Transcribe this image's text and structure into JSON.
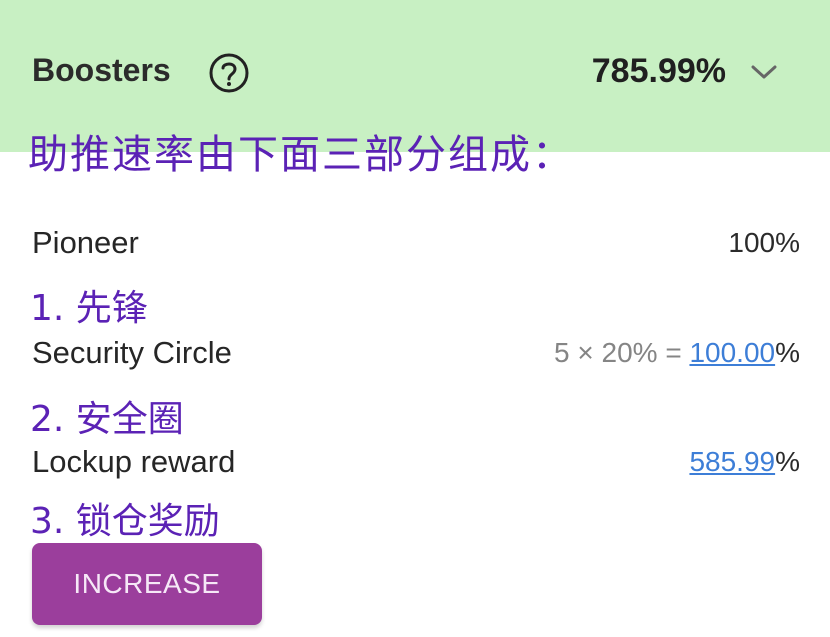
{
  "header": {
    "title": "Boosters",
    "help_icon": "question-circle-icon",
    "total": "785.99%",
    "expand_icon": "chevron-down-icon",
    "background_color": "#c8f0c3"
  },
  "annotations": {
    "main": "助推速率由下面三部分组成：",
    "item1": "1. 先锋",
    "item2": "2. 安全圈",
    "item3": "3. 锁仓奖励",
    "color": "#5b22b5"
  },
  "rows": [
    {
      "label": "Pioneer",
      "value": "100%"
    },
    {
      "label": "Security Circle",
      "formula": "5 × 20% = ",
      "link_value": "100.00",
      "suffix": "%"
    },
    {
      "label": "Lockup reward",
      "link_value": "585.99",
      "suffix": "%"
    }
  ],
  "actions": {
    "increase_label": "INCREASE",
    "button_color": "#9b3e9c"
  }
}
